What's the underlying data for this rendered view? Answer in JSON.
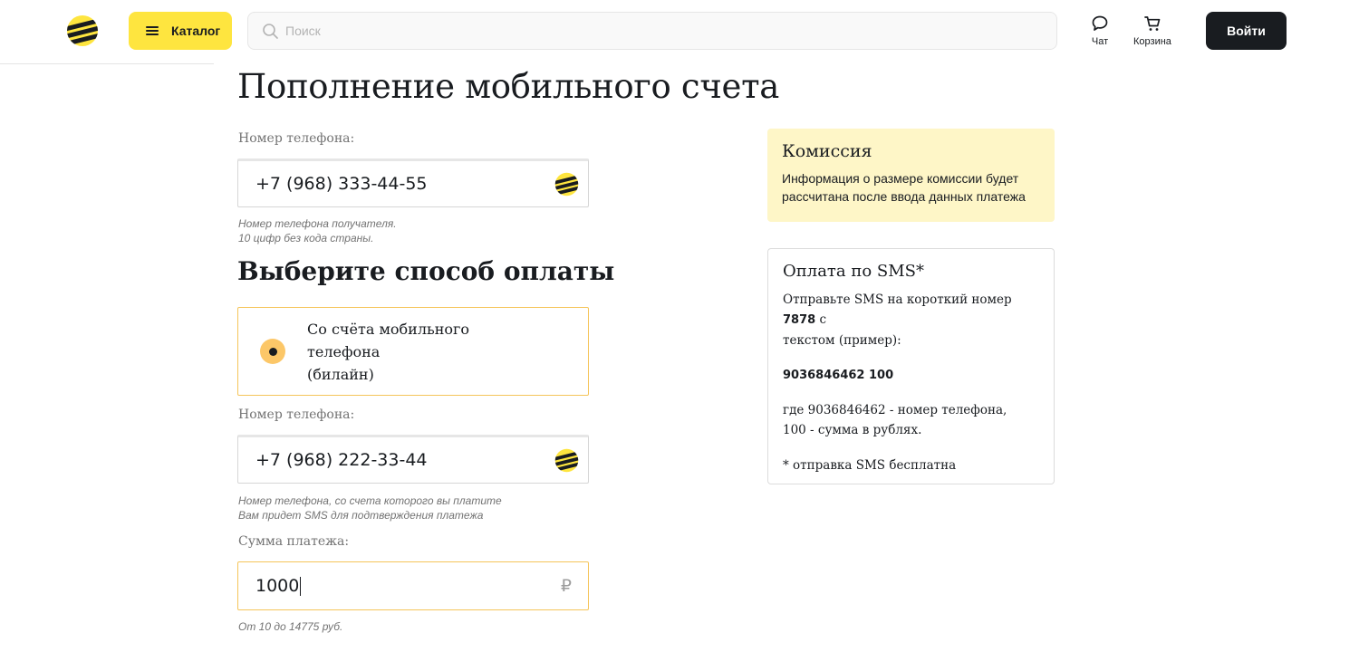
{
  "header": {
    "catalog_label": "Каталог",
    "search_placeholder": "Поиск",
    "chat_label": "Чат",
    "cart_label": "Корзина",
    "login_label": "Войти"
  },
  "main": {
    "title": "Пополнение мобильного счета",
    "recipient": {
      "label": "Номер телефона:",
      "value": "+7 (968) 333-44-55",
      "hint_line1": "Номер телефона получателя.",
      "hint_line2": "10 цифр без кода страны."
    },
    "payment_method_title": "Выберите способ оплаты",
    "payment_option": {
      "line1": "Со счёта мобильного телефона",
      "line2": "(билайн)",
      "selected": true
    },
    "payer": {
      "label": "Номер телефона:",
      "value": "+7 (968) 222-33-44",
      "hint_line1": "Номер телефона, со счета которого вы платите",
      "hint_line2": "Вам придет SMS для подтверждения платежа"
    },
    "amount": {
      "label": "Сумма платежа:",
      "value": "1000",
      "currency": "₽",
      "hint": "От 10 до 14775 руб."
    }
  },
  "sidebar": {
    "commission": {
      "title": "Комиссия",
      "text_line1": "Информация о размере комиссии будет",
      "text_line2": "рассчитана после ввода данных платежа"
    },
    "sms": {
      "title": "Оплата по SMS*",
      "text_before": "Отправьте SMS на короткий номер ",
      "short_number": "7878",
      "text_after": " с",
      "text_line2": "текстом (пример):",
      "example": "9036846462 100",
      "where_line1": "где 9036846462 - номер телефона,",
      "where_line2": "100 - сумма в рублях.",
      "free_note": "* отправка SMS бесплатна"
    }
  },
  "colors": {
    "brand_yellow": "#fee53f",
    "accent_border": "#f5c55a",
    "commission_bg": "#fef6c7",
    "dark": "#191c20"
  }
}
